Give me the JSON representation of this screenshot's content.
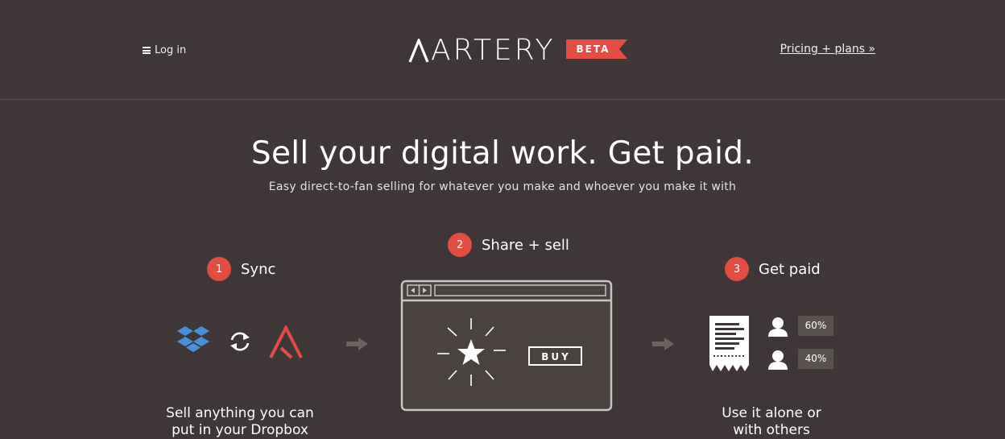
{
  "header": {
    "login_label": "Log in",
    "logo_text": "ARTERY",
    "beta_badge": "BETA",
    "pricing_link": "Pricing + plans »"
  },
  "hero": {
    "title": "Sell your digital work. Get paid.",
    "subtitle": "Easy direct-to-fan selling for whatever you make and whoever you make it with"
  },
  "steps": [
    {
      "number": "1",
      "title": "Sync",
      "description_line1": "Sell anything you can",
      "description_line2": "put in your Dropbox"
    },
    {
      "number": "2",
      "title": "Share + sell",
      "buy_label": "BUY"
    },
    {
      "number": "3",
      "title": "Get paid",
      "description_line1": "Use it alone or",
      "description_line2": "with others",
      "splits": [
        "60%",
        "40%"
      ]
    }
  ],
  "colors": {
    "background": "#3f3737",
    "accent": "#e24c43",
    "dropbox_blue": "#4a90d9",
    "divider": "#5d5454"
  }
}
